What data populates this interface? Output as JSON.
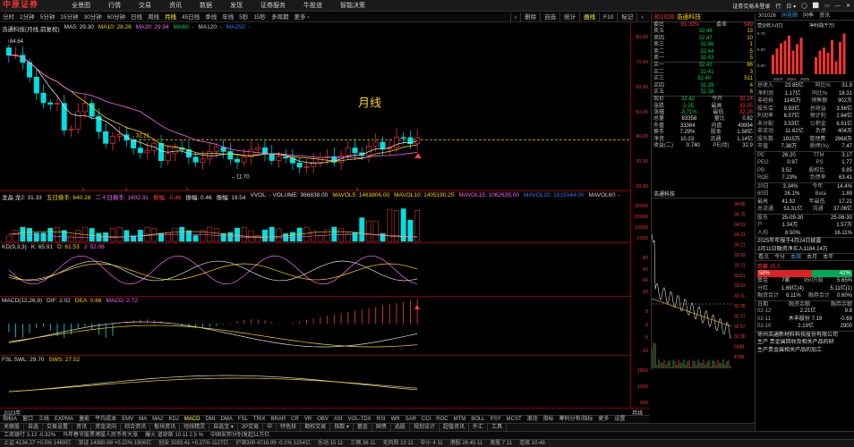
{
  "app": {
    "logo": "中原证券",
    "menu": [
      "全景图",
      "行情",
      "交易",
      "资讯",
      "数据",
      "发现",
      "证券服务",
      "牛股道",
      "智能决策"
    ],
    "top_right": [
      "证券交易未登录",
      "行",
      "日 ▾",
      "◯",
      "⬜",
      "▭",
      "—",
      "✕"
    ]
  },
  "periods": [
    "分时",
    "1分钟",
    "5分钟",
    "15分钟",
    "30分钟",
    "60分钟",
    "日线",
    "周线",
    "月线",
    "45日线",
    "季线",
    "年线",
    "5秒",
    "15秒",
    "多周期",
    "更多 ›"
  ],
  "active_period": "月线",
  "right_tools": [
    "‹",
    "删除",
    "自选",
    "统计",
    "画线",
    "F10",
    "标记",
    "‹"
  ],
  "main_pane": {
    "legend": [
      {
        "text": "浩通科技(月线,前复权)",
        "color": "#ddd"
      },
      {
        "text": "MA5: 29.30",
        "color": "#ddd"
      },
      {
        "text": "MA10: 28.26",
        "color": "#ffd400"
      },
      {
        "text": "MA20: 29.94",
        "color": "#ff66ff"
      },
      {
        "text": "MA60: -",
        "color": "#00d45a"
      },
      {
        "text": "MA120: -",
        "color": "#ccc"
      },
      {
        "text": "MA250: -",
        "color": "#3a7aff"
      }
    ],
    "high_label": "84.64",
    "low_label": "11.70",
    "mark_label": "32.21",
    "title_note": "月线",
    "y_ticks": [
      "80.00",
      "70.00",
      "60.00",
      "50.00",
      "40.00",
      "30.00",
      "20.00"
    ]
  },
  "vol_pane": {
    "legend": [
      {
        "text": "龙晶 龙2: 31.33",
        "color": "#ddd"
      },
      {
        "text": "五日换手: 640.28",
        "color": "#ffd400"
      },
      {
        "text": "二十日换手: 1602.31",
        "color": "#ff66ff"
      },
      {
        "text": "振幅: -0.46",
        "color": "#ff3b3b"
      },
      {
        "text": "振幅: 0.46",
        "color": "#ddd"
      },
      {
        "text": "振幅: 19.54",
        "color": "#ddd"
      },
      {
        "text": "VVOL: - VOLUME: 986838.00",
        "color": "#ddd"
      },
      {
        "text": "MAVOL5: 1463806.00",
        "color": "#ffd400"
      },
      {
        "text": "MAVOL10: 1405190.25",
        "color": "#ffd400"
      },
      {
        "text": "MAVOL15: 1062635.00",
        "color": "#ff66ff"
      },
      {
        "text": "MAVOL20: 1015044.00",
        "color": "#3a7aff"
      },
      {
        "text": "MAVOL60: -",
        "color": "#ccc"
      }
    ],
    "y_ticks": [
      "30000",
      "20000",
      "10000",
      "X100"
    ]
  },
  "kd_pane": {
    "legend": [
      {
        "text": "KD(9,3,3)",
        "color": "#ddd"
      },
      {
        "text": "K: 65.91",
        "color": "#ddd"
      },
      {
        "text": "D: 61.53",
        "color": "#ffd400"
      },
      {
        "text": "J: 52.06",
        "color": "#ff66ff"
      }
    ],
    "y_ticks": [
      "80",
      "60",
      "40",
      "20"
    ]
  },
  "macd_pane": {
    "legend": [
      {
        "text": "MACD(12,26,9)",
        "color": "#ddd"
      },
      {
        "text": "DIF: 2.02",
        "color": "#ddd"
      },
      {
        "text": "DEA: 0.66",
        "color": "#ffd400"
      },
      {
        "text": "MACD: 2.72",
        "color": "#ff66ff"
      }
    ],
    "y_ticks": [
      "8",
      "0",
      "-5",
      "-10"
    ]
  },
  "swl_pane": {
    "legend": [
      {
        "text": "FSL SWL: 29.70",
        "color": "#ddd"
      },
      {
        "text": "SWS: 27.52",
        "color": "#ffd400"
      }
    ],
    "y_ticks": [
      "1800",
      "1000",
      "600"
    ]
  },
  "x_labels": {
    "left": "2023年",
    "right": "月线"
  },
  "indicator_tabs": [
    "指标A",
    "窗口",
    "三线",
    "EXPMA",
    "量能",
    "平均成本",
    "EMV",
    "MA",
    "MA2",
    "KDJ",
    "MACD",
    "DMI",
    "DMA",
    "FSL",
    "TRIX",
    "BRAR",
    "CR",
    "VR",
    "OBV",
    "ASI",
    "VOL-TDX",
    "RSI",
    "WR",
    "SAR",
    "CCI",
    "ROC",
    "MTM",
    "BOLL",
    "PSY",
    "MCST",
    "滚动",
    "指标",
    "筹码分布/指标",
    "更多",
    "设置"
  ],
  "active_indicator": "MACD",
  "quote": {
    "code": "301026",
    "name": "浩通科技",
    "wei_bi_label": "委比",
    "wei_bi": "81.33%",
    "wei_cha_label": "委差",
    "wei_cha": "549",
    "asks": [
      {
        "n": "卖五",
        "p": "32.48",
        "v": "13"
      },
      {
        "n": "卖四",
        "p": "32.47",
        "v": "10"
      },
      {
        "n": "卖三",
        "p": "32.46",
        "v": "1"
      },
      {
        "n": "卖二",
        "p": "32.44",
        "v": "5"
      },
      {
        "n": "卖一",
        "p": "32.43",
        "v": "5"
      }
    ],
    "bids": [
      {
        "n": "买一",
        "p": "32.42",
        "v": "86"
      },
      {
        "n": "买二",
        "p": "32.41",
        "v": "3"
      },
      {
        "n": "买三",
        "p": "32.40",
        "v": "511"
      },
      {
        "n": "买四",
        "p": "32.39",
        "v": "4"
      },
      {
        "n": "买五",
        "p": "32.38",
        "v": "6"
      }
    ],
    "stats": [
      {
        "k": "现价",
        "v": "32.42",
        "k2": "今开",
        "v2": "32.24"
      },
      {
        "k": "涨跌",
        "v": "-1.25",
        "k2": "最高",
        "v2": "33.55"
      },
      {
        "k": "涨幅",
        "v": "-3.71%",
        "k2": "最低",
        "v2": "32.28"
      },
      {
        "k": "总量",
        "v": "83358",
        "k2": "量比",
        "v2": "0.82"
      },
      {
        "k": "外盘",
        "v": "33364",
        "k2": "内盘",
        "v2": "49994"
      },
      {
        "k": "换手",
        "v": "7.29%",
        "k2": "股本",
        "v2": "1.58亿"
      },
      {
        "k": "净资",
        "v": "10.23",
        "k2": "流通",
        "v2": "1.14亿"
      },
      {
        "k": "收益(二)",
        "v": "0.740",
        "k2": "PE(动)",
        "v2": "32.9"
      }
    ],
    "mini_title": "浩通科技",
    "mini_y": [
      "34.85",
      "34.75",
      "34.51",
      "34.31",
      "34.21",
      "33.93",
      "33.71",
      "33.61",
      "33.31",
      "33.11",
      "32.95",
      "32.77",
      "32.57",
      "32.36",
      "5598",
      "4798"
    ]
  },
  "far": {
    "code": "301026",
    "tabs": [
      "同花顺",
      "同季",
      "资讯"
    ],
    "chart_titles": [
      "营业收入(亿)",
      "净利润(千万)"
    ],
    "rev_vals": [
      "6.78",
      "5.00",
      "0.00"
    ],
    "years": [
      "2023",
      "2024",
      "2025"
    ],
    "rows": [
      {
        "k": "总收入",
        "v": "23.85亿",
        "k2": "同比%",
        "v2": "31.9"
      },
      {
        "k": "净利润",
        "v": "1.17亿",
        "k2": "同比%",
        "v2": "18.31"
      },
      {
        "k": "非经损",
        "v": "1145万",
        "k2": "销售额",
        "v2": "902万"
      },
      {
        "k": "股东会",
        "v": "9.93亿",
        "k2": "总收益",
        "v2": "3.56亿"
      },
      {
        "k": "利润率",
        "v": "8.57亿",
        "k2": "预计利",
        "v2": "2.64亿"
      },
      {
        "k": "未分配",
        "v": "3.53亿",
        "k2": "公积金",
        "v2": "6.61亿"
      },
      {
        "k": "非流动",
        "v": "11.62亿",
        "k2": "负债",
        "v2": "404万"
      },
      {
        "k": "股东数",
        "v": "1915万",
        "k2": "管理费",
        "v2": "2668万"
      },
      {
        "k": "市值",
        "v": "7.38万",
        "k2": "质押(%)",
        "v2": "7.47"
      }
    ],
    "ratios": [
      {
        "k": "PE",
        "v": "26.20",
        "k2": "TTM",
        "v2": "3.17"
      },
      {
        "k": "PEG",
        "v": "0.97",
        "k2": "PS",
        "v2": "1.77"
      },
      {
        "k": "PB",
        "v": "3.52",
        "k2": "股权比",
        "v2": "9.85"
      },
      {
        "k": "ROE",
        "v": "7.23%",
        "k2": "负债率",
        "v2": "63.41"
      }
    ],
    "period": [
      {
        "k": "20日",
        "v": "3.34%",
        "k2": "今年",
        "v2": "14.4%"
      },
      {
        "k": "60日",
        "v": "26.1%",
        "k2": "Beta",
        "v2": "1.89"
      },
      {
        "k": "最高",
        "v": "41.92",
        "k2": "年最低",
        "v2": "17.21"
      },
      {
        "k": "总流通",
        "v": "51.31亿",
        "k2": "流通",
        "v2": "37.06亿"
      }
    ],
    "holders": [
      {
        "k": "股东",
        "v": "25-09-30",
        "k2": "",
        "v2": "25-06-30"
      },
      {
        "k": "户",
        "v": "1.34万",
        "k2": "",
        "v2": "1.57万"
      },
      {
        "k": "人均",
        "v": "6.50%",
        "k2": "",
        "v2": "16.11%"
      }
    ],
    "notes": [
      "2025年年报于4月24日披露",
      "2月11日融资净买入1184.14万"
    ],
    "view_tabs": [
      "看点",
      "今分",
      "本周",
      "本月",
      "本年"
    ],
    "updown": {
      "up_label": "跑赢",
      "up": "25人",
      "pct_up": "58%",
      "pct_dn": "42%"
    },
    "vals": [
      {
        "k": "基金",
        "v": "7家",
        "k2": "950万股",
        "v2": "5.65%"
      },
      {
        "k": "分红",
        "v": "1.69亿(4)",
        "k2": "",
        "v2": "5.11亿(1)"
      },
      {
        "k": "融资合计",
        "v": "6.11%",
        "k2": "融券合计",
        "v2": "0.60%"
      }
    ],
    "margin_head": [
      "日期",
      "融资余额",
      "融券余额"
    ],
    "margin": [
      {
        "d": "02-12",
        "a": "2.21亿",
        "b": "9.8"
      },
      {
        "d": "02-11",
        "a": "木丰股份 7.19",
        "b": "-0.69"
      },
      {
        "d": "02-10",
        "a": "2.19亿",
        "b": "2900"
      }
    ],
    "news": [
      "徐州浩通新材料科技股份有限公司",
      "生产 贵金属回收及相关产品的研",
      "生产贵金属相关产品的加工"
    ]
  },
  "nav": [
    "关联股",
    "自选",
    "交易设置",
    "资讯",
    "资金流向",
    "综合资讯",
    "板块资讯",
    "短线精灵",
    "自选宝 ▾",
    "",
    "",
    "",
    "2P交易",
    "中",
    "特色技",
    "期权交易",
    "指数 ▾",
    "基金",
    "国债",
    "选股",
    "规划设计",
    "超值资讯",
    "外汇",
    "工具"
  ],
  "ticker": [
    "工商银行 3.12 -0.32%",
    "马年春节股票港股人民币有大涨",
    "爆火 道琼斯 10 11 2.5 %",
    "中国安邦分别发起11万亿"
  ],
  "status": [
    "上证 4134.27 +0.5% 1469亿",
    "深证 14380.88 +0.22% 1906亿",
    "创业 3283.41 +0.27% 1127亿",
    "沪深300 4716.99 -0.1% 1254亿",
    "乐动 15 11",
    "三钢 36 11",
    "无风险 13 11",
    "中小 4 11",
    "港股 26 45 11",
    "美股 7 11",
    "连接 10:48"
  ]
}
